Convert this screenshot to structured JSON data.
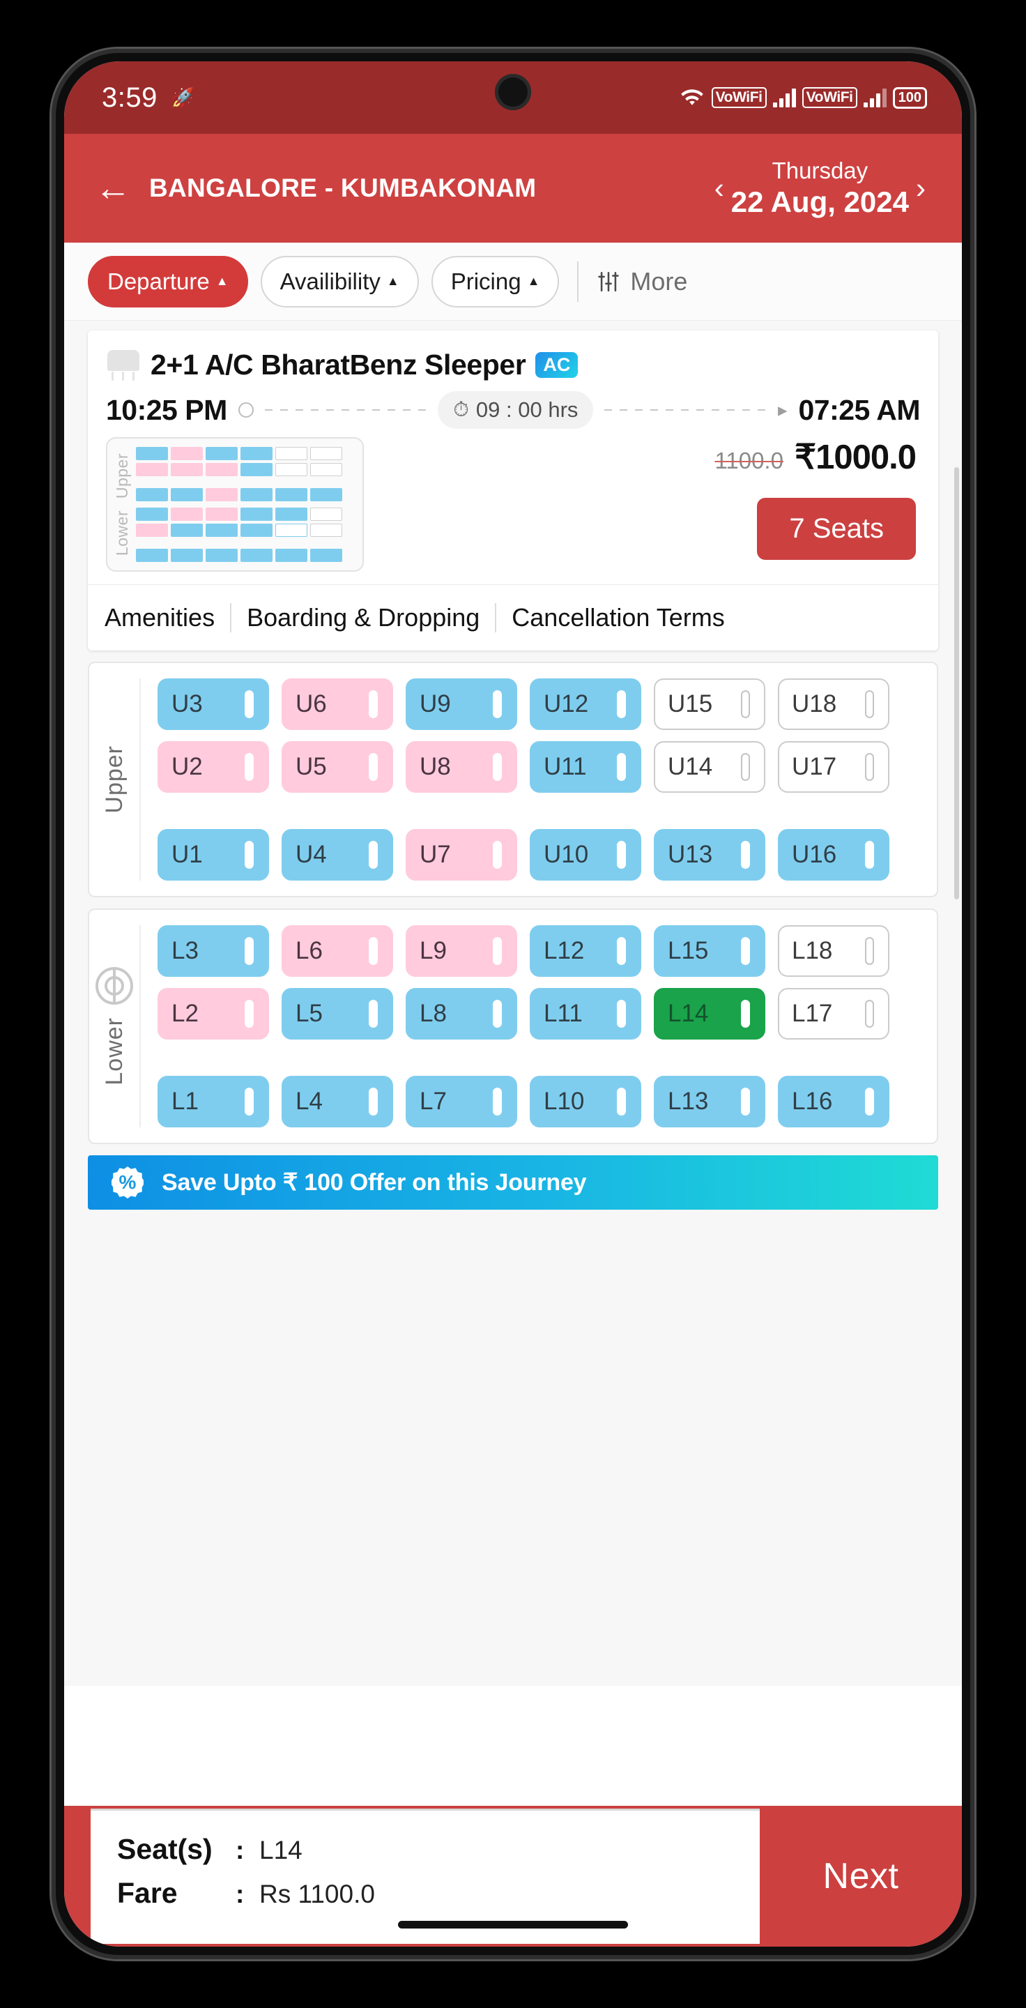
{
  "status_bar": {
    "time": "3:59",
    "rocket_icon": "rocket-icon",
    "wifi_icon": "wifi-icon",
    "vowifi_1": "VoWiFi",
    "vowifi_2": "VoWiFi",
    "battery": "100"
  },
  "header": {
    "back_icon": "back-arrow-icon",
    "route": "BANGALORE - KUMBAKONAM",
    "prev_icon": "chevron-left-icon",
    "weekday": "Thursday",
    "date": "22 Aug, 2024",
    "next_icon": "chevron-right-icon"
  },
  "filters": {
    "chips": [
      {
        "label": "Departure",
        "caret": "▲",
        "active": true
      },
      {
        "label": "Availibility",
        "caret": "▲",
        "active": false
      },
      {
        "label": "Pricing",
        "caret": "▲",
        "active": false
      }
    ],
    "more_label": "More",
    "more_icon": "filter-sliders-icon"
  },
  "bus_card": {
    "icon": "bus-seat-icon",
    "name": "2+1 A/C BharatBenz Sleeper",
    "ac_badge": "AC",
    "departure_time": "10:25 PM",
    "duration": "09 : 00 hrs",
    "duration_icon": "stopwatch-icon",
    "arrival_time": "07:25 AM",
    "old_price": "1100.0",
    "new_price": "₹1000.0",
    "seats_button": "7 Seats",
    "mini_map": {
      "upper_label": "Upper",
      "lower_label": "Lower",
      "upper_rows": [
        [
          "m",
          "f",
          "m",
          "m",
          "a",
          "a"
        ],
        [
          "f",
          "f",
          "f",
          "m",
          "a",
          "a"
        ],
        [
          "m",
          "m",
          "f",
          "m",
          "m",
          "m"
        ]
      ],
      "lower_rows": [
        [
          "m",
          "f",
          "f",
          "m",
          "m",
          "a"
        ],
        [
          "f",
          "m",
          "m",
          "m",
          "sel",
          "a"
        ],
        [
          "m",
          "m",
          "m",
          "m",
          "m",
          "m"
        ]
      ]
    },
    "tabs": [
      "Amenities",
      "Boarding & Dropping",
      "Cancellation Terms"
    ]
  },
  "seat_map": {
    "upper": {
      "label": "Upper",
      "rows": [
        [
          {
            "id": "U3",
            "state": "male"
          },
          {
            "id": "U6",
            "state": "female"
          },
          {
            "id": "U9",
            "state": "male"
          },
          {
            "id": "U12",
            "state": "male"
          },
          {
            "id": "U15",
            "state": "available"
          },
          {
            "id": "U18",
            "state": "available"
          }
        ],
        [
          {
            "id": "U2",
            "state": "female"
          },
          {
            "id": "U5",
            "state": "female"
          },
          {
            "id": "U8",
            "state": "female"
          },
          {
            "id": "U11",
            "state": "male"
          },
          {
            "id": "U14",
            "state": "available"
          },
          {
            "id": "U17",
            "state": "available"
          }
        ],
        [
          {
            "id": "U1",
            "state": "male"
          },
          {
            "id": "U4",
            "state": "male"
          },
          {
            "id": "U7",
            "state": "female"
          },
          {
            "id": "U10",
            "state": "male"
          },
          {
            "id": "U13",
            "state": "male"
          },
          {
            "id": "U16",
            "state": "male"
          }
        ]
      ]
    },
    "lower": {
      "label": "Lower",
      "steering_icon": "steering-wheel-icon",
      "rows": [
        [
          {
            "id": "L3",
            "state": "male"
          },
          {
            "id": "L6",
            "state": "female"
          },
          {
            "id": "L9",
            "state": "female"
          },
          {
            "id": "L12",
            "state": "male"
          },
          {
            "id": "L15",
            "state": "male"
          },
          {
            "id": "L18",
            "state": "available"
          }
        ],
        [
          {
            "id": "L2",
            "state": "female"
          },
          {
            "id": "L5",
            "state": "male"
          },
          {
            "id": "L8",
            "state": "male"
          },
          {
            "id": "L11",
            "state": "male"
          },
          {
            "id": "L14",
            "state": "selected"
          },
          {
            "id": "L17",
            "state": "available"
          }
        ],
        [
          {
            "id": "L1",
            "state": "male"
          },
          {
            "id": "L4",
            "state": "male"
          },
          {
            "id": "L7",
            "state": "male"
          },
          {
            "id": "L10",
            "state": "male"
          },
          {
            "id": "L13",
            "state": "male"
          },
          {
            "id": "L16",
            "state": "male"
          }
        ]
      ]
    }
  },
  "offer": {
    "icon": "percent-badge-icon",
    "text": "Save Upto ₹ 100 Offer on this Journey"
  },
  "bottom": {
    "seats_label": "Seat(s)",
    "seats_colon": ":",
    "seats_value": "L14",
    "fare_label": "Fare",
    "fare_colon": ":",
    "fare_value": "Rs 1100.0",
    "next_label": "Next"
  },
  "colors": {
    "status_bar_red": "#9a2b2b",
    "header_red": "#ce4141",
    "accent_red": "#cc4040",
    "seat_male": "#7fcdee",
    "seat_female": "#ffcbdd",
    "seat_selected": "#1aa34a",
    "offer_gradient_start": "#0e8fe4",
    "offer_gradient_end": "#1fdbd5",
    "ac_badge": "#1f8fe8"
  }
}
